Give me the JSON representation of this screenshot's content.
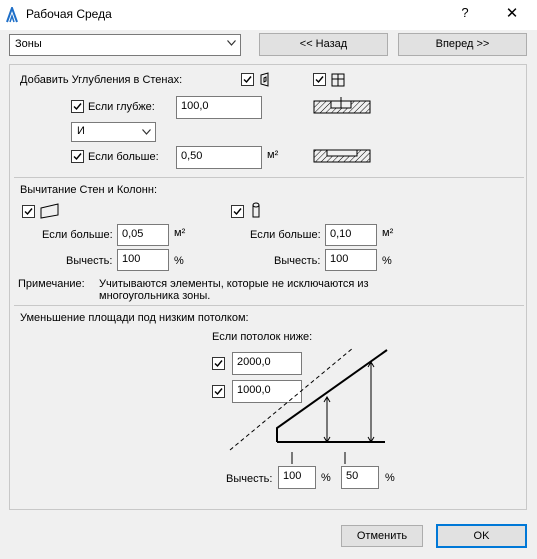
{
  "window": {
    "title": "Рабочая Среда",
    "help": "?",
    "close": "✕"
  },
  "toolbar": {
    "zone_select": "Зоны",
    "back_label": "<< Назад",
    "forward_label": "Вперед >>"
  },
  "niches": {
    "heading": "Добавить Углубления в Стенах:",
    "deeper_label": "Если глубже:",
    "deeper_value": "100,0",
    "logic_select": "И",
    "larger_label": "Если больше:",
    "larger_value": "0,50",
    "unit_m2": "м²"
  },
  "subtract": {
    "heading": "Вычитание Стен и Колонн:",
    "walls_larger_label": "Если больше:",
    "walls_larger_value": "0,05",
    "walls_subtract_label": "Вычесть:",
    "walls_subtract_value": "100",
    "columns_larger_label": "Если больше:",
    "columns_larger_value": "0,10",
    "columns_subtract_label": "Вычесть:",
    "columns_subtract_value": "100",
    "unit_m2": "м²",
    "unit_pct": "%",
    "note_label": "Примечание:",
    "note_line1": "Учитываются элементы, которые не исключаются из",
    "note_line2": "многоугольника зоны."
  },
  "ceiling": {
    "heading": "Уменьшение площади под низким потолком:",
    "if_lower_label": "Если потолок ниже:",
    "height1_value": "2000,0",
    "height2_value": "1000,0",
    "subtract_label": "Вычесть:",
    "subtract1_value": "100",
    "subtract2_value": "50",
    "unit_pct": "%"
  },
  "footer": {
    "cancel_label": "Отменить",
    "ok_label": "OK"
  },
  "colors": {
    "accent": "#0078d7",
    "button_face": "#e1e1e1",
    "window_bg": "#f0f0f0"
  }
}
